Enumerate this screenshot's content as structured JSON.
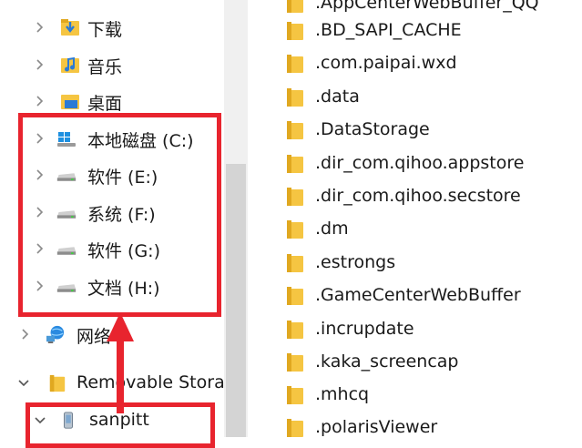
{
  "nav": {
    "items": [
      {
        "label": "下载",
        "icon": "download-folder-icon"
      },
      {
        "label": "音乐",
        "icon": "music-folder-icon"
      },
      {
        "label": "桌面",
        "icon": "desktop-folder-icon"
      },
      {
        "label": "本地磁盘 (C:)",
        "icon": "windows-drive-icon"
      },
      {
        "label": "软件 (E:)",
        "icon": "drive-icon"
      },
      {
        "label": "系统 (F:)",
        "icon": "drive-icon"
      },
      {
        "label": "软件 (G:)",
        "icon": "drive-icon"
      },
      {
        "label": "文档 (H:)",
        "icon": "drive-icon"
      },
      {
        "label": "网络",
        "icon": "network-icon"
      },
      {
        "label": "Removable Stora",
        "icon": "folder-icon"
      },
      {
        "label": "sanpitt",
        "icon": "phone-icon"
      }
    ]
  },
  "files": {
    "items": [
      ".AppCenterWebBuffer_QQ",
      ".BD_SAPI_CACHE",
      ".com.paipai.wxd",
      ".data",
      ".DataStorage",
      ".dir_com.qihoo.appstore",
      ".dir_com.qihoo.secstore",
      ".dm",
      ".estrongs",
      ".GameCenterWebBuffer",
      ".incrupdate",
      ".kaka_screencap",
      ".mhcq",
      ".polarisViewer"
    ]
  },
  "colors": {
    "annotation": "#e8242e",
    "folder": "#f5c542",
    "folder_dark": "#e0a820"
  }
}
